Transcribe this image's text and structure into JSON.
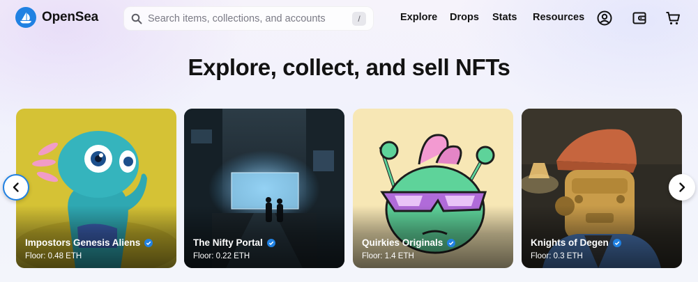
{
  "brand": {
    "name": "OpenSea",
    "accent": "#2081e2"
  },
  "search": {
    "placeholder": "Search items, collections, and accounts",
    "value": "",
    "shortcut": "/"
  },
  "nav": [
    {
      "label": "Explore"
    },
    {
      "label": "Drops"
    },
    {
      "label": "Stats"
    },
    {
      "label": "Resources"
    }
  ],
  "nav_icons": [
    "account-icon",
    "wallet-icon",
    "cart-icon"
  ],
  "hero": {
    "title": "Explore, collect, and sell NFTs"
  },
  "carousel": {
    "prev_icon": "chevron-left-icon",
    "next_icon": "chevron-right-icon",
    "cards": [
      {
        "name": "Impostors Genesis Aliens",
        "floor": "Floor: 0.48 ETH",
        "verified": true,
        "bg": "#d3c132"
      },
      {
        "name": "The Nifty Portal",
        "floor": "Floor: 0.22 ETH",
        "verified": true,
        "bg": "#1d2a33"
      },
      {
        "name": "Quirkies Originals",
        "floor": "Floor: 1.4 ETH",
        "verified": true,
        "bg": "#f6e6b6"
      },
      {
        "name": "Knights of Degen",
        "floor": "Floor: 0.3 ETH",
        "verified": true,
        "bg": "#2e2a22"
      }
    ]
  }
}
